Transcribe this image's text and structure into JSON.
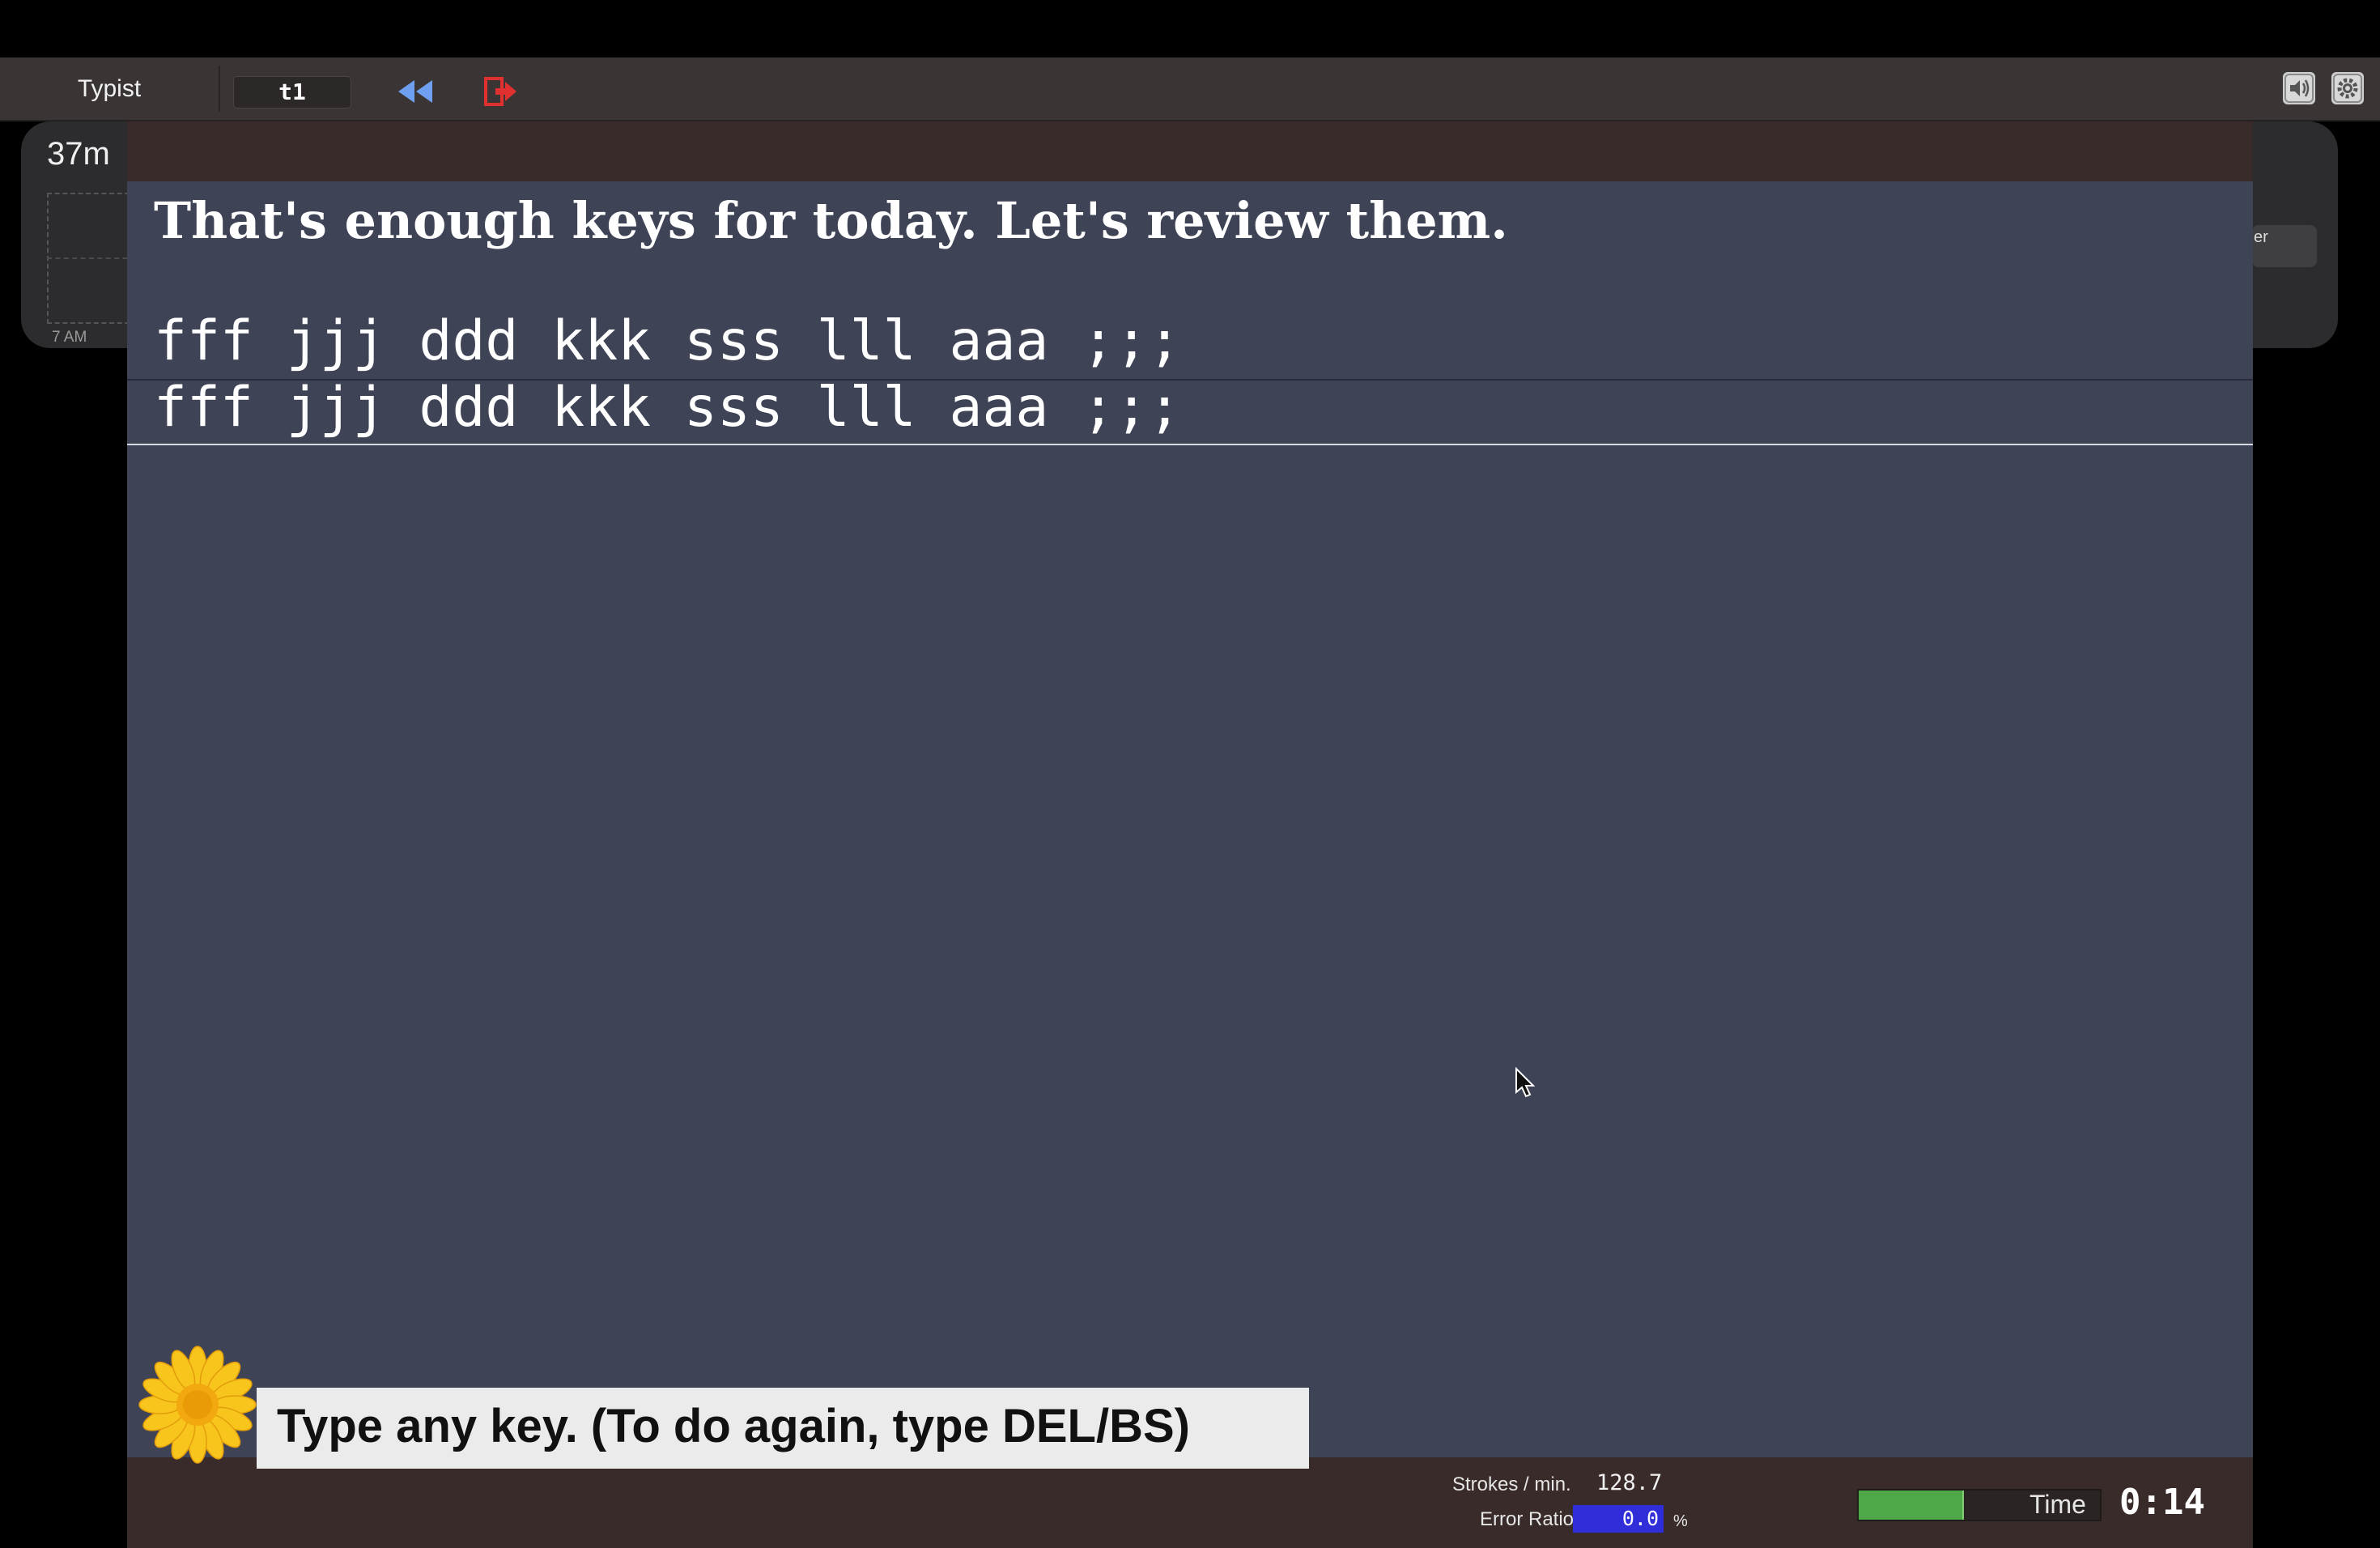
{
  "toolbar": {
    "app_title": "Typist",
    "lesson_id": "t1",
    "icons": {
      "rewind": "rewind-icon",
      "exit": "exit-icon",
      "sound": "speaker-icon",
      "settings": "gear-icon"
    },
    "colors": {
      "rewind": "#6f9ff0",
      "exit": "#e03030"
    }
  },
  "background_widget": {
    "duration": "37m",
    "hour_label": "7 AM",
    "right_button_fragment": "er"
  },
  "lesson": {
    "instruction": "That's enough keys for today. Let's review them.",
    "target_line": "fff jjj ddd kkk sss lll aaa ;;;",
    "typed_line": "fff jjj ddd kkk sss lll aaa ;;;",
    "prompt": "Type any key. (To do again, type DEL/BS)",
    "prompt_icon": "sunflower-icon"
  },
  "status": {
    "strokes_label": "Strokes / min.",
    "strokes_value": "128.7",
    "error_label": "Error Ratio",
    "error_value": "0.0",
    "error_unit": "%",
    "progress": 0.43,
    "time_label": "Time",
    "time_value": "0:14",
    "colors": {
      "progress": "#4fa848",
      "error_box": "#2f2ed8"
    }
  }
}
